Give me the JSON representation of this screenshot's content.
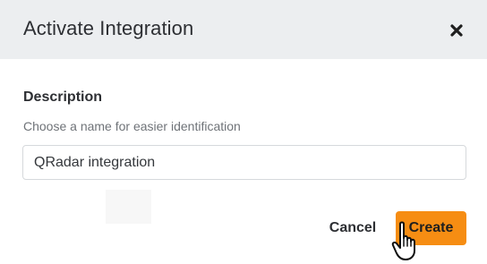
{
  "dialog": {
    "title": "Activate Integration",
    "close_icon": "close-icon"
  },
  "form": {
    "description": {
      "label": "Description",
      "help": "Choose a name for easier identification",
      "value": "QRadar integration"
    }
  },
  "actions": {
    "cancel_label": "Cancel",
    "create_label": "Create"
  },
  "colors": {
    "header_bg": "#eceef0",
    "primary": "#f68d13",
    "text": "#2d2f33"
  },
  "cursor_icon": "hand-pointer-icon"
}
